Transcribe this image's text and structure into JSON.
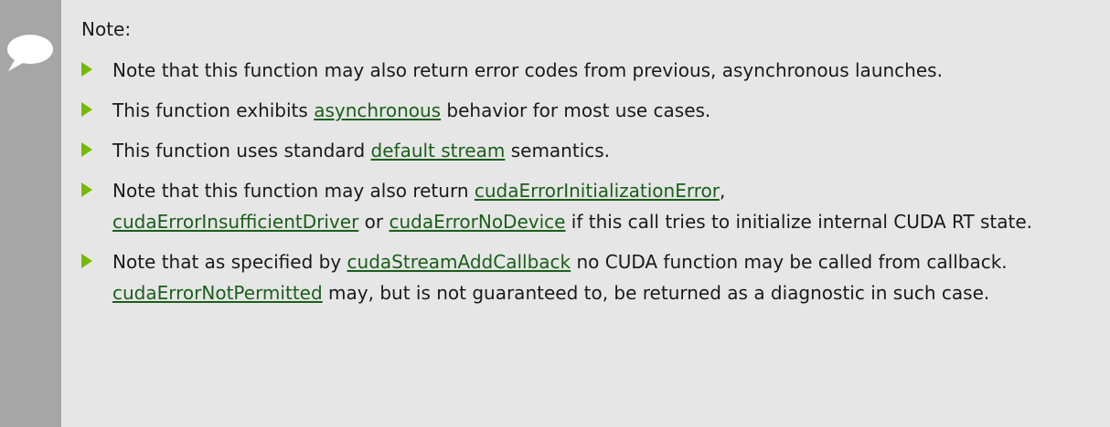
{
  "note": {
    "title": "Note:",
    "icon": "speech-bubble-icon",
    "colors": {
      "background": "#e6e6e6",
      "sidebar": "#a6a6a6",
      "bullet": "#76b900",
      "link": "#1a5e1a"
    },
    "items": [
      {
        "text": "Note that this function may also return error codes from previous, asynchronous launches."
      },
      {
        "before": "This function exhibits ",
        "link": "asynchronous",
        "after": " behavior for most use cases."
      },
      {
        "before": "This function uses standard ",
        "link": "default stream",
        "after": " semantics."
      },
      {
        "before": "Note that this function may also return ",
        "link1": "cudaErrorInitializationError",
        "mid1": ", ",
        "link2": "cudaErrorInsufficientDriver",
        "mid2": " or ",
        "link3": "cudaErrorNoDevice",
        "after": " if this call tries to initialize internal CUDA RT state."
      },
      {
        "before": "Note that as specified by ",
        "link1": "cudaStreamAddCallback",
        "mid1": " no CUDA function may be called from callback. ",
        "link2": "cudaErrorNotPermitted",
        "after": " may, but is not guaranteed to, be returned as a diagnostic in such case."
      }
    ]
  }
}
